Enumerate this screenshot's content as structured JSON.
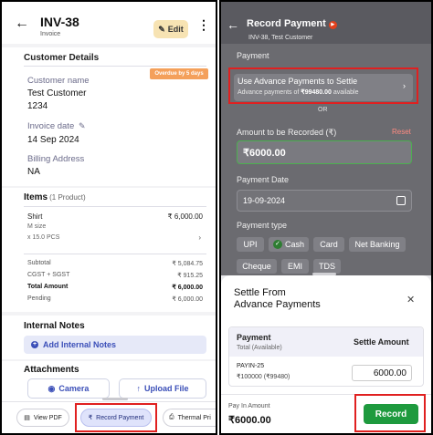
{
  "invoice_screen": {
    "header": {
      "title": "INV-38",
      "subtitle": "Invoice",
      "edit_label": "Edit"
    },
    "customer": {
      "section_title": "Customer Details",
      "badge": "Overdue by 5 days",
      "name_label": "Customer name",
      "name_line1": "Test Customer",
      "name_line2": "1234",
      "date_label": "Invoice date",
      "date_value": "14 Sep 2024",
      "billing_label": "Billing Address",
      "billing_value": "NA"
    },
    "items": {
      "title": "Items",
      "count": "(1 Product)",
      "rows": [
        {
          "name": "Shirt",
          "size": "M size",
          "qty": "x 15.0 PCS",
          "price": "₹ 6,000.00"
        }
      ]
    },
    "summary": [
      {
        "label": "Subtotal",
        "value": "₹ 5,084.75"
      },
      {
        "label": "CGST + SGST",
        "value": "₹ 915.25"
      },
      {
        "label": "Total Amount",
        "value": "₹ 6,000.00"
      },
      {
        "label": "Pending",
        "value": "₹ 6,000.00"
      }
    ],
    "notes": {
      "title": "Internal Notes",
      "add_label": "Add Internal Notes"
    },
    "attachments": {
      "title": "Attachments",
      "camera_label": "Camera",
      "upload_label": "Upload File"
    },
    "bottom_bar": {
      "view_pdf": "View PDF",
      "record_payment": "Record Payment",
      "thermal": "Thermal Pri"
    }
  },
  "payment_screen": {
    "header": {
      "title": "Record Payment",
      "subtitle": "INV-38, Test Customer"
    },
    "payment_label": "Payment",
    "advance": {
      "title": "Use Advance Payments to Settle",
      "sub_prefix": "Advance payments of ",
      "sub_amount": "₹99480.00",
      "sub_suffix": " available"
    },
    "or_label": "OR",
    "amount_label": "Amount to be Recorded (₹)",
    "reset_label": "Reset",
    "amount_value": "₹6000.00",
    "date_label": "Payment Date",
    "date_value": "19-09-2024",
    "type_label": "Payment type",
    "types": [
      "UPI",
      "Cash",
      "Card",
      "Net Banking",
      "Cheque",
      "EMI",
      "TDS"
    ],
    "selected_type": "Cash"
  },
  "settle_sheet": {
    "title_line1": "Settle From",
    "title_line2": "Advance Payments",
    "col_payment": "Payment",
    "col_total": "Total (Available)",
    "col_settle": "Settle Amount",
    "rows": [
      {
        "id": "PAYIN-25",
        "detail": "₹100000 (₹99480)",
        "settle": "6000.00"
      }
    ],
    "pay_in_label": "Pay In Amount",
    "pay_in_value": "₹6000.00",
    "record_label": "Record"
  },
  "colors": {
    "record_green": "#1e9a3e",
    "highlight_red": "#e02020",
    "accent_blue": "#3b4fb8",
    "overdue_orange": "#f4a05b"
  }
}
